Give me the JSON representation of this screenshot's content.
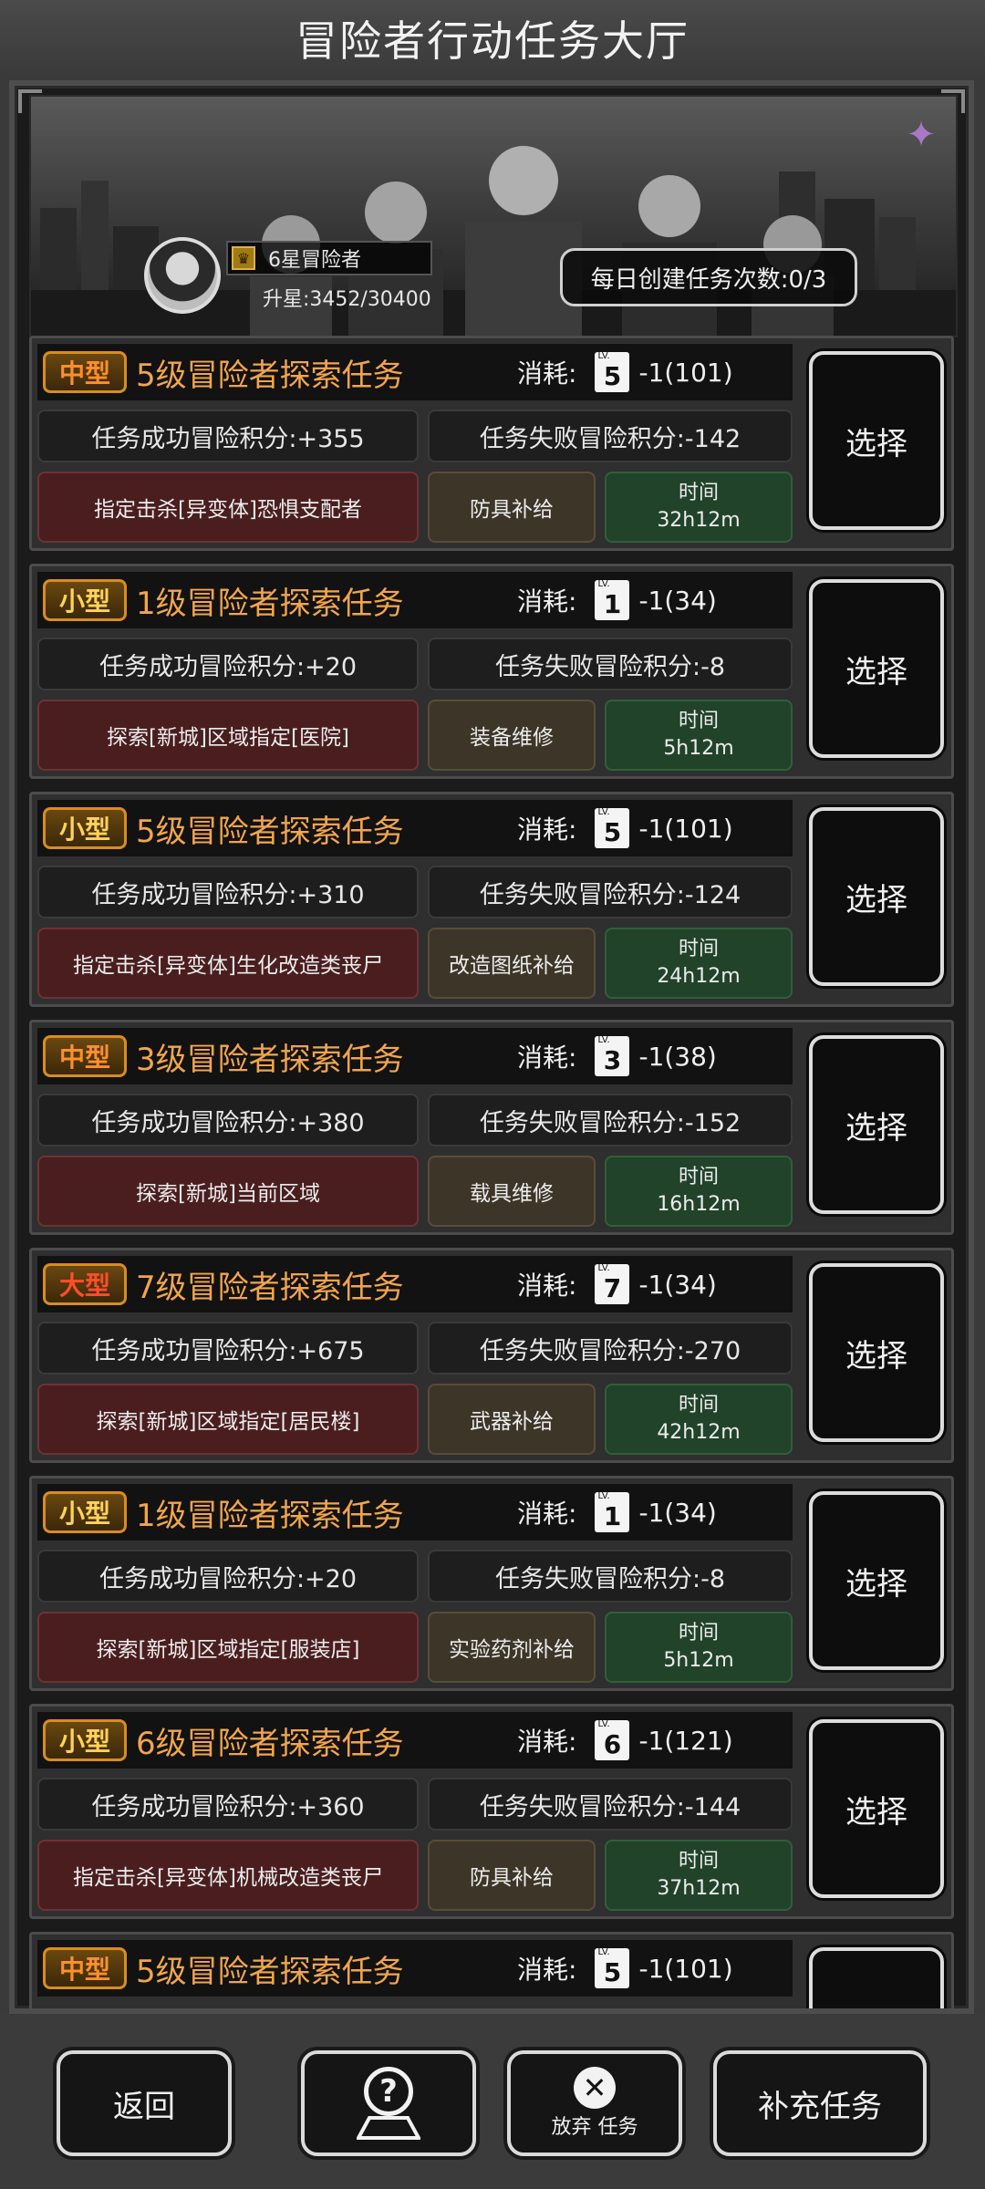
{
  "header": {
    "title": "冒险者行动任务大厅"
  },
  "player": {
    "rank": "6星冒险者",
    "upgrade": "升星:3452/30400",
    "daily_tasks": "每日创建任务次数:0/3"
  },
  "labels": {
    "cost": "消耗:",
    "time": "时间",
    "select": "选择"
  },
  "tasks": [
    {
      "size": "中型",
      "title": "5级冒险者探索任务",
      "lv": "5",
      "cost": "-1(101)",
      "success": "任务成功冒险积分:+355",
      "fail": "任务失败冒险积分:-142",
      "target": "指定击杀[异变体]恐惧支配者",
      "reward": "防具补给",
      "time": "32h12m"
    },
    {
      "size": "小型",
      "title": "1级冒险者探索任务",
      "lv": "1",
      "cost": "-1(34)",
      "success": "任务成功冒险积分:+20",
      "fail": "任务失败冒险积分:-8",
      "target": "探索[新城]区域指定[医院]",
      "reward": "装备维修",
      "time": "5h12m"
    },
    {
      "size": "小型",
      "title": "5级冒险者探索任务",
      "lv": "5",
      "cost": "-1(101)",
      "success": "任务成功冒险积分:+310",
      "fail": "任务失败冒险积分:-124",
      "target": "指定击杀[异变体]生化改造类丧尸",
      "reward": "改造图纸补给",
      "time": "24h12m"
    },
    {
      "size": "中型",
      "title": "3级冒险者探索任务",
      "lv": "3",
      "cost": "-1(38)",
      "success": "任务成功冒险积分:+380",
      "fail": "任务失败冒险积分:-152",
      "target": "探索[新城]当前区域",
      "reward": "载具维修",
      "time": "16h12m"
    },
    {
      "size": "大型",
      "title": "7级冒险者探索任务",
      "lv": "7",
      "cost": "-1(34)",
      "success": "任务成功冒险积分:+675",
      "fail": "任务失败冒险积分:-270",
      "target": "探索[新城]区域指定[居民楼]",
      "reward": "武器补给",
      "time": "42h12m"
    },
    {
      "size": "小型",
      "title": "1级冒险者探索任务",
      "lv": "1",
      "cost": "-1(34)",
      "success": "任务成功冒险积分:+20",
      "fail": "任务失败冒险积分:-8",
      "target": "探索[新城]区域指定[服装店]",
      "reward": "实验药剂补给",
      "time": "5h12m"
    },
    {
      "size": "小型",
      "title": "6级冒险者探索任务",
      "lv": "6",
      "cost": "-1(121)",
      "success": "任务成功冒险积分:+360",
      "fail": "任务失败冒险积分:-144",
      "target": "指定击杀[异变体]机械改造类丧尸",
      "reward": "防具补给",
      "time": "37h12m"
    },
    {
      "size": "中型",
      "title": "5级冒险者探索任务",
      "lv": "5",
      "cost": "-1(101)",
      "success": "",
      "fail": "",
      "target": "",
      "reward": "",
      "time": ""
    }
  ],
  "footer": {
    "back": "返回",
    "abandon_a": "放弃",
    "abandon_b": "任务",
    "refill": "补充任务"
  }
}
